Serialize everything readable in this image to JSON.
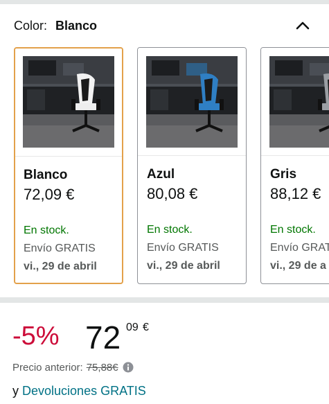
{
  "colors": {
    "selected_border": "#e3a14a",
    "card_border": "#8d9096",
    "in_stock": "#007600",
    "discount": "#cc0c39",
    "link": "#007185",
    "muted_text": "#565959"
  },
  "color_selector": {
    "label": "Color:",
    "value": "Blanco",
    "collapse_icon": "chevron-up-icon"
  },
  "swatches": [
    {
      "name": "Blanco",
      "price": "72,09 €",
      "stock": "En stock.",
      "shipping": "Envío GRATIS",
      "delivery": "vi., 29 de abril",
      "selected": true,
      "chair_color": "white"
    },
    {
      "name": "Azul",
      "price": "80,08 €",
      "stock": "En stock.",
      "shipping": "Envío GRATIS",
      "delivery": "vi., 29 de abril",
      "selected": false,
      "chair_color": "blue"
    },
    {
      "name": "Gris",
      "price": "88,12 €",
      "stock": "En stock.",
      "shipping": "Envío GRAT",
      "delivery": "vi., 29 de a",
      "selected": false,
      "chair_color": "grey"
    }
  ],
  "pricing": {
    "discount": "-5%",
    "price_whole": "72",
    "price_cents": "09",
    "currency": "€",
    "previous_label": "Precio anterior:",
    "previous_price": "75,88€",
    "info_icon": "info-icon"
  },
  "returns": {
    "prefix": "y",
    "link": "Devoluciones GRATIS"
  }
}
